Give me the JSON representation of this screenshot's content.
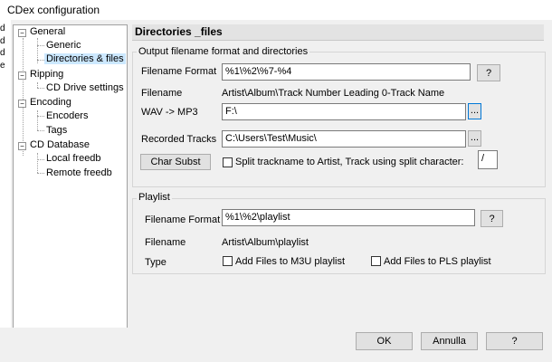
{
  "window": {
    "title": "CDex configuration"
  },
  "left_strip_chars": [
    "d",
    "d",
    "d",
    "e"
  ],
  "tree": {
    "general": "General",
    "generic": "Generic",
    "directories": "Directories & files",
    "ripping": "Ripping",
    "cd_drive": "CD Drive settings",
    "encoding": "Encoding",
    "encoders": "Encoders",
    "tags": "Tags",
    "cd_database": "CD Database",
    "local_freedb": "Local freedb",
    "remote_freedb": "Remote freedb"
  },
  "panel": {
    "title": "Directories _files",
    "output_group": {
      "label": "Output filename format and directories",
      "filename_format_label": "Filename Format",
      "filename_format_value": "%1\\%2\\%7-%4",
      "help": "?",
      "filename_label": "Filename",
      "filename_value": "Artist\\Album\\Track Number Leading 0-Track Name",
      "wav_label": "WAV -> MP3",
      "wav_value": "F:\\",
      "browse": "...",
      "recorded_label": "Recorded Tracks",
      "recorded_value": "C:\\Users\\Test\\Music\\",
      "char_subst": "Char Subst",
      "split_label": "Split trackname to Artist, Track using split character:",
      "split_char": "/"
    },
    "playlist_group": {
      "label": "Playlist",
      "filename_format_label": "Filename Format",
      "filename_format_value": "%1\\%2\\playlist",
      "help": "?",
      "filename_label": "Filename",
      "filename_value": "Artist\\Album\\playlist",
      "type_label": "Type",
      "m3u_label": "Add Files to M3U playlist",
      "pls_label": "Add Files to PLS playlist"
    }
  },
  "buttons": {
    "ok": "OK",
    "cancel": "Annulla",
    "help": "?"
  }
}
